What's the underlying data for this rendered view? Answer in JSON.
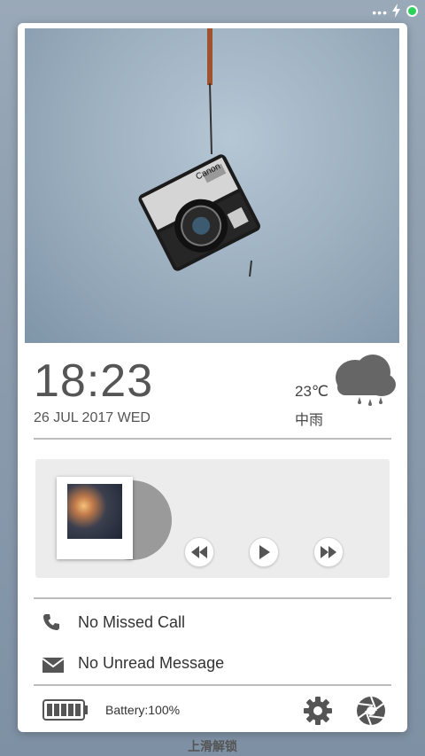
{
  "status_bar": {
    "dots": "•••"
  },
  "clock": {
    "time": "18:23",
    "date": "26 JUL 2017 WED"
  },
  "weather": {
    "temperature": "23℃",
    "description": "中雨",
    "icon": "rain-cloud-icon"
  },
  "photo": {
    "camera_brand": "Canon"
  },
  "music": {
    "controls": [
      {
        "name": "rewind",
        "icon": "rewind-icon"
      },
      {
        "name": "play",
        "icon": "play-icon"
      },
      {
        "name": "fast-forward",
        "icon": "fast-forward-icon"
      }
    ]
  },
  "notifications": {
    "missed_call": "No Missed Call",
    "unread_message": "No Unread Message"
  },
  "footer": {
    "battery_label": "Battery:100%",
    "battery_level": 1.0
  },
  "unlock_hint": "上滑解锁",
  "colors": {
    "status_led": "#2ed158",
    "card_bg": "#ffffff",
    "text": "#555555",
    "player_bg": "#ececec"
  }
}
